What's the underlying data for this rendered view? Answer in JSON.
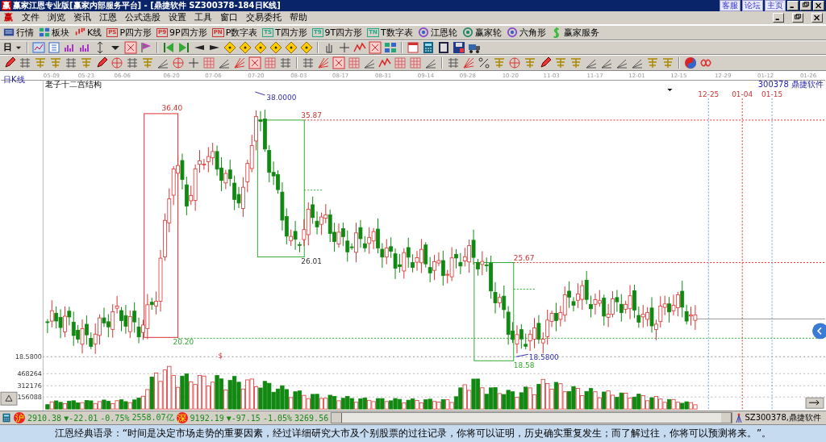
{
  "window": {
    "logo": "赢",
    "title": "赢家江恩专业版[赢家内部服务平台] - [鼎捷软件   SZ300378-184日K线]",
    "links": [
      "客服",
      "论坛",
      "主页"
    ]
  },
  "menu": {
    "logo": "赢",
    "items": [
      "文件",
      "浏览",
      "资讯",
      "江恩",
      "公式选股",
      "设置",
      "工具",
      "窗口",
      "交易委托",
      "帮助"
    ]
  },
  "toolbar": [
    {
      "label": "行情"
    },
    {
      "label": "板块"
    },
    {
      "label": "K线"
    },
    {
      "label": "P四方形",
      "badge": "PS"
    },
    {
      "label": "9P四方形",
      "badge": "P9"
    },
    {
      "label": "P数字表",
      "badge": "PN"
    },
    {
      "label": "T四方形",
      "badge": "TS"
    },
    {
      "label": "9T四方形",
      "badge": "T9"
    },
    {
      "label": "T数字表",
      "badge": "TN"
    },
    {
      "label": "江恩轮"
    },
    {
      "label": "赢家轮"
    },
    {
      "label": "六角形"
    },
    {
      "label": "赢家服务"
    }
  ],
  "toolbar2": {
    "period": "日"
  },
  "chart": {
    "period": "日K线",
    "title": "老子十二宫结构",
    "stock": "300378 鼎捷软件",
    "dates": [
      "05-09",
      "05-23",
      "06-06",
      "06-20",
      "07-06",
      "07-20",
      "08-03",
      "08-17",
      "08-31",
      "09-14",
      "09-28",
      "10-20",
      "11-03",
      "11-17",
      "12-01",
      "12-15",
      "12-29",
      "01-12",
      "01-26"
    ],
    "price_labels": [
      "36.40",
      "38.0000",
      "35.87",
      "26.01",
      "25.67",
      "20.20",
      "18.5800",
      "18.58"
    ],
    "date_marks": [
      "12-25",
      "01-04",
      "01-15"
    ],
    "marker": "$"
  },
  "volume": {
    "axis_labels": [
      "18.5800",
      "468264",
      "312176",
      "156088"
    ]
  },
  "status": {
    "indices": [
      {
        "badge": "沪",
        "value": "2910.38",
        "change": "▼-22.01",
        "percent": "-0.75%",
        "amount": "2558.07亿"
      },
      {
        "badge": "深",
        "value": "9192.19",
        "change": "▼-97.15",
        "percent": "-1.05%",
        "amount": "3269.56"
      }
    ],
    "stock": "SZ300378,鼎捷软件"
  },
  "quote": "江恩经典语录：“时间是决定市场走势的重要因素，经过详细研究大市及个别股票的过往记录，你将可以证明，历史确实重复发生；而了解过往，你将可以预测将来。”。"
}
